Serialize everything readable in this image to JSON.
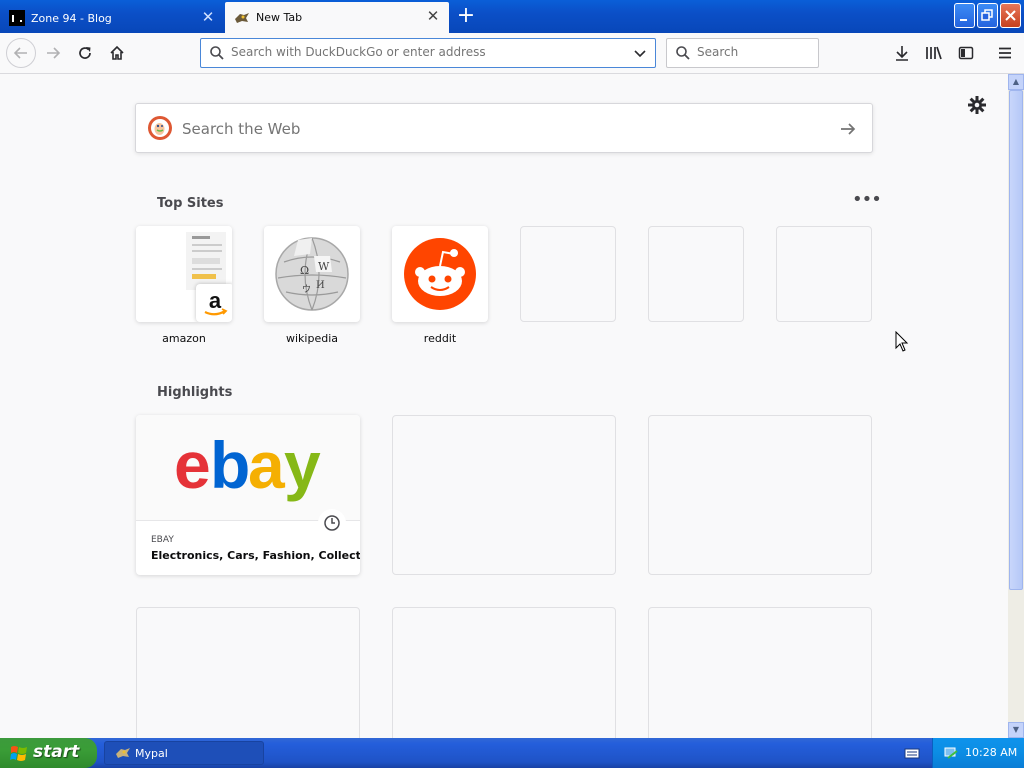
{
  "tabs": [
    {
      "title": "Zone 94 - Blog",
      "active": false
    },
    {
      "title": "New Tab",
      "active": true
    }
  ],
  "urlbar": {
    "placeholder": "Search with DuckDuckGo or enter address"
  },
  "searchbar": {
    "placeholder": "Search"
  },
  "newtab_search": {
    "placeholder": "Search the Web"
  },
  "top_sites": {
    "title": "Top Sites",
    "items": [
      {
        "label": "amazon"
      },
      {
        "label": "wikipedia"
      },
      {
        "label": "reddit"
      }
    ]
  },
  "highlights": {
    "title": "Highlights",
    "card": {
      "site": "EBAY",
      "title": "Electronics, Cars, Fashion, Collect..."
    }
  },
  "taskbar": {
    "start_label": "start",
    "task_label": "Mypal",
    "clock": "10:28 AM"
  },
  "colors": {
    "titlebar": "#0b4fc7",
    "reddit": "#ff4500",
    "ebay_red": "#e53238",
    "ebay_blue": "#0064d2",
    "ebay_yellow": "#f5af02",
    "ebay_green": "#86b817"
  }
}
